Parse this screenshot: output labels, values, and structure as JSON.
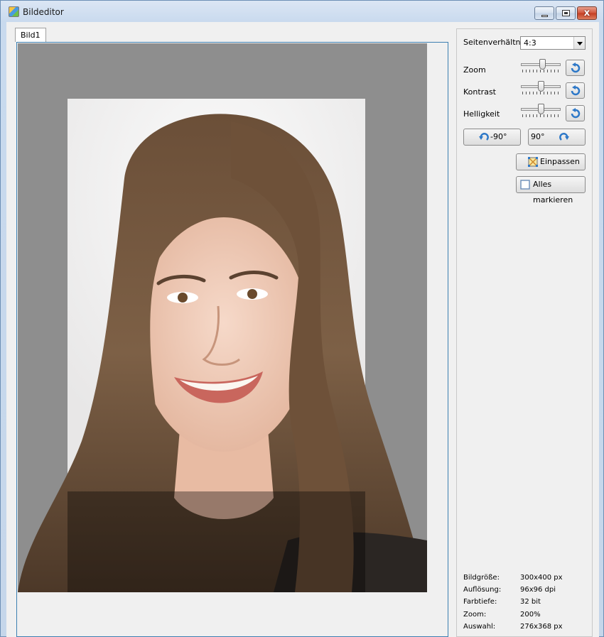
{
  "window": {
    "title": "Bildeditor",
    "close_glyph": "x"
  },
  "tabs": [
    {
      "label": "Bild1"
    }
  ],
  "controls": {
    "aspect_label": "Seitenverhältnis",
    "aspect_value": "4:3",
    "zoom_label": "Zoom",
    "zoom_level": 0.55,
    "contrast_label": "Kontrast",
    "contrast_level": 0.5,
    "brightness_label": "Helligkeit",
    "brightness_level": 0.5,
    "rotate_left_label": "-90°",
    "rotate_right_label": "90°",
    "fit_label": "Einpassen",
    "select_all_label": "Alles markieren"
  },
  "info": [
    {
      "label": "Bildgröße:",
      "value": "300x400 px"
    },
    {
      "label": "Auflösung:",
      "value": "96x96 dpi"
    },
    {
      "label": "Farbtiefe:",
      "value": "32 bit"
    },
    {
      "label": "Zoom:",
      "value": "200%"
    },
    {
      "label": "Auswahl:",
      "value": "276x368 px"
    }
  ],
  "colors": {
    "tab_border": "#3c7fb1",
    "canvas_bg": "#8e8e8e",
    "crop_area": "#f4f3f2",
    "accent_icon": "#2d78c8"
  },
  "icons": [
    "app-icon",
    "minimize-icon",
    "maximize-icon",
    "close-icon",
    "reset-icon",
    "rotate-left-icon",
    "rotate-right-icon",
    "fit-icon",
    "select-all-icon",
    "dropdown-arrow-icon"
  ]
}
